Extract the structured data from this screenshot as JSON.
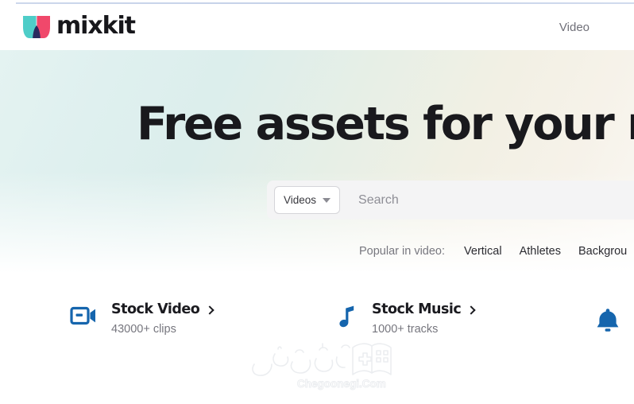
{
  "brand": {
    "name": "mixkit",
    "logo_icon": "mixkit-bowtie-logo",
    "colors": {
      "logo_teal": "#4ecdc8",
      "logo_pink": "#f0486b",
      "logo_navy": "#2a2a5e",
      "accent_blue": "#1565ad",
      "text_dark": "#19191d",
      "text_muted": "#77777f",
      "hero_gradient_start": "#e0f1ef",
      "hero_gradient_end": "#faf8f3",
      "search_bg": "#f4f4f5"
    }
  },
  "header": {
    "nav_items": [
      {
        "label": "Video",
        "name": "nav-item-video"
      },
      {
        "label": "",
        "name": "nav-item-cut-off"
      }
    ]
  },
  "hero": {
    "title": "Free assets for your next",
    "search": {
      "category_label": "Videos",
      "category_icon": "chevron-down-icon",
      "placeholder": "Search",
      "value": ""
    },
    "popular": {
      "label": "Popular in video:",
      "links": [
        "Vertical",
        "Athletes",
        "Backgrou"
      ]
    }
  },
  "categories": [
    {
      "title": "Stock Video",
      "subtitle": "43000+ clips",
      "icon": "video-camera-icon",
      "arrow_icon": "chevron-right-icon"
    },
    {
      "title": "Stock Music",
      "subtitle": "1000+ tracks",
      "icon": "music-note-icon",
      "arrow_icon": "chevron-right-icon"
    }
  ],
  "notification": {
    "icon": "bell-icon"
  },
  "watermark": {
    "text": "Chegoonegi.Com",
    "icon": "book-gamepad-outline"
  }
}
